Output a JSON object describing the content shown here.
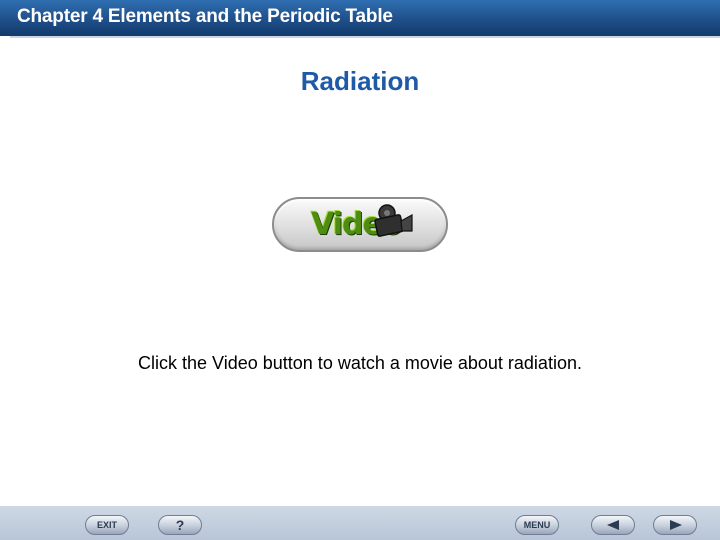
{
  "header": {
    "title": "Chapter 4  Elements and the Periodic Table"
  },
  "slide": {
    "title": "Radiation",
    "video_button_label": "Video",
    "instruction": "Click the Video button to watch a movie about radiation."
  },
  "footer": {
    "exit_label": "EXIT",
    "help_label": "?",
    "menu_label": "MENU"
  },
  "icons": {
    "video": "camera-icon",
    "back": "arrow-left-icon",
    "next": "arrow-right-icon"
  },
  "colors": {
    "header": "#1f4f8a",
    "title": "#1f5aa6",
    "video_text": "#4f8d12",
    "footer": "#c3cfde"
  }
}
